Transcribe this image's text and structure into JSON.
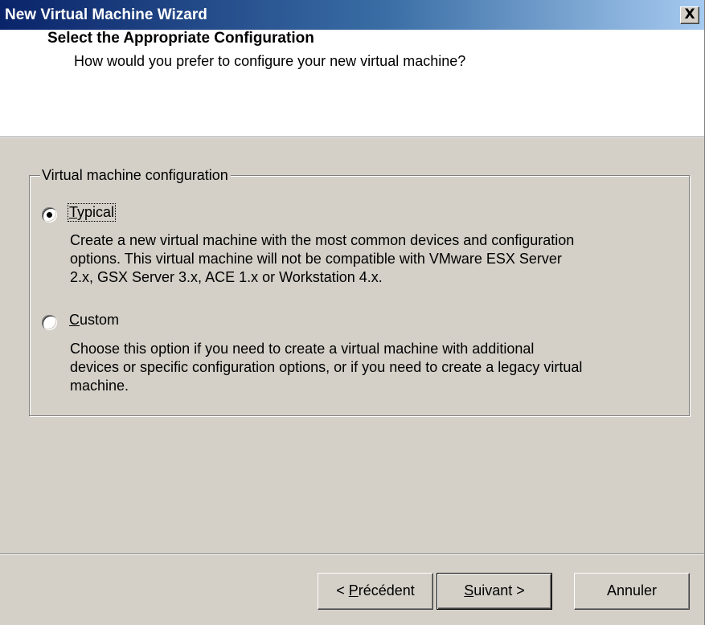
{
  "window": {
    "title": "New Virtual Machine Wizard",
    "close_glyph": "X"
  },
  "header": {
    "title": "Select the Appropriate Configuration",
    "subtitle": "How would you prefer to configure your new virtual machine?"
  },
  "config_group": {
    "legend": "Virtual machine configuration",
    "selected": "typical",
    "options": [
      {
        "id": "typical",
        "mnemonic": "T",
        "label_rest": "ypical",
        "checked": true,
        "description": [
          "Create a new virtual machine with the most common devices and configuration",
          "options. This virtual machine will not be compatible with VMware ESX Server",
          "2.x, GSX Server 3.x, ACE 1.x or Workstation 4.x."
        ]
      },
      {
        "id": "custom",
        "mnemonic": "C",
        "label_rest": "ustom",
        "checked": false,
        "description": [
          "Choose this option if you need to create a virtual machine with additional",
          "devices or specific configuration options, or if you need to create a legacy virtual",
          "machine."
        ]
      }
    ]
  },
  "buttons": {
    "back_prefix": "< ",
    "back_mnemonic": "P",
    "back_rest": "récédent",
    "next_mnemonic": "S",
    "next_rest": "uivant >",
    "cancel": "Annuler"
  },
  "colors": {
    "dialog_face": "#d4d0c8",
    "titlebar_start": "#0a246a",
    "titlebar_end": "#a6caf0"
  }
}
